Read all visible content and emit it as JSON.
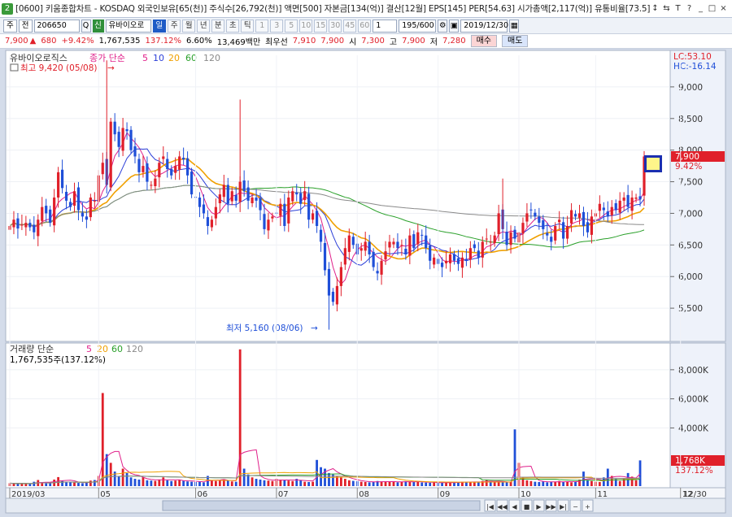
{
  "window": {
    "badge": "2",
    "title": "[0600] 키움종합차트 - KOSDAQ 외국인보유[65(천)] 주식수[26,792(천)] 액면[500] 자본금[134(억)] 결산[12월] EPS[145] PER[54.63] 시가총액[2,117(억)] 유통비율[73.5]",
    "controls": [
      "↕",
      "⇆",
      "T",
      "?",
      "_",
      "□",
      "×"
    ]
  },
  "toolbar": {
    "type": "주",
    "sep": "전",
    "code": "206650",
    "search_icon": "Q",
    "name_badge": "신",
    "name": "유바이오로",
    "periods": [
      "일",
      "주",
      "월",
      "년",
      "분",
      "초",
      "틱"
    ],
    "active_period": "일",
    "minutes": [
      "1",
      "3",
      "5",
      "10",
      "15",
      "30",
      "45",
      "60"
    ],
    "min_sel": "1",
    "count": "195/600",
    "date": "2019/12/30"
  },
  "info": {
    "price": "7,900",
    "arrow": "▲",
    "change": "680",
    "pct": "+9.42%",
    "volume": "1,767,535",
    "vol_ratio": "137.12%",
    "turnover": "6.60%",
    "amount": "13,469백만",
    "best_label": "최우선",
    "best1": "7,910",
    "best2": "7,900",
    "open_label": "시",
    "open": "7,300",
    "high_label": "고",
    "high": "7,900",
    "low_label": "저",
    "low": "7,280",
    "buy": "매수",
    "sell": "매도"
  },
  "price_panel": {
    "name": "유바이오로직스",
    "ma_label": "종가 단순",
    "ma": [
      "5",
      "10",
      "20",
      "60",
      "120"
    ],
    "ma_colors": [
      "#e0208a",
      "#2c3fd8",
      "#f0a000",
      "#2aa02a",
      "#8a8a8a"
    ],
    "high_note": "최고 9,420 (05/08)",
    "low_note": "최저 5,160 (08/06)",
    "lc": "LC:53.10",
    "hc": "HC:-16.14",
    "yaxis": [
      "9,000",
      "8,500",
      "8,000",
      "7,500",
      "7,000",
      "6,500",
      "6,000",
      "5,500"
    ],
    "last_price": "7,900",
    "last_pct": "9.42%"
  },
  "volume_panel": {
    "title": "거래량 단순",
    "ma": [
      "5",
      "20",
      "60",
      "120"
    ],
    "current": "1,767,535주(137.12%)",
    "yaxis": [
      "8,000K",
      "6,000K",
      "4,000K"
    ],
    "last_vol": "1,768K",
    "last_pct": "137.12%"
  },
  "xaxis": {
    "labels": [
      "2019/03",
      "05",
      "06",
      "07",
      "08",
      "09",
      "10",
      "11",
      "12"
    ],
    "end_label": "12/30"
  },
  "navigator": {
    "buttons": [
      "|◀",
      "◀◀",
      "◀",
      "■",
      "▶",
      "▶▶",
      "▶|",
      "−",
      "+"
    ]
  },
  "chart_data": {
    "type": "candlestick",
    "price_range": [
      5000,
      9500
    ],
    "volume_range": [
      0,
      9500000
    ],
    "closes": [
      6800,
      6900,
      6760,
      6820,
      6850,
      6780,
      6700,
      6900,
      7100,
      7000,
      6850,
      7250,
      7650,
      7400,
      7200,
      7100,
      7350,
      7050,
      6950,
      6900,
      7250,
      7200,
      7600,
      7800,
      7450,
      8450,
      8250,
      8050,
      8350,
      8300,
      8000,
      7900,
      7650,
      7750,
      7500,
      7450,
      7550,
      7800,
      7900,
      7700,
      7600,
      7750,
      7900,
      7850,
      7600,
      7300,
      7250,
      7100,
      7000,
      6800,
      6900,
      7100,
      7300,
      7450,
      7150,
      7350,
      7200,
      7500,
      7350,
      7200,
      7250,
      7200,
      7050,
      6750,
      6900,
      6950,
      7000,
      7150,
      6800,
      7250,
      7350,
      7300,
      7150,
      7350,
      6900,
      7000,
      6800,
      6550,
      6100,
      5700,
      5600,
      5850,
      6150,
      6450,
      6650,
      6500,
      6350,
      6450,
      6550,
      6350,
      6150,
      6050,
      6250,
      6400,
      6550,
      6550,
      6450,
      6500,
      6350,
      6650,
      6450,
      6700,
      6650,
      6450,
      6250,
      6300,
      6200,
      6150,
      6250,
      6350,
      6250,
      6200,
      6300,
      6250,
      6450,
      6450,
      6300,
      6550,
      6600,
      6550,
      6650,
      7000,
      6750,
      6500,
      6700,
      6600,
      6700,
      6850,
      7000,
      7050,
      6950,
      6850,
      6750,
      6650,
      6550,
      6800,
      6900,
      6600,
      6800,
      7050,
      6950,
      7000,
      6800,
      6700,
      6950,
      7000,
      7150,
      7050,
      6950,
      7100,
      7050,
      7200,
      7250,
      7100,
      7250,
      7250,
      7220,
      7900
    ],
    "volumes_k": [
      200,
      180,
      160,
      220,
      150,
      140,
      300,
      420,
      260,
      190,
      200,
      450,
      620,
      380,
      300,
      260,
      250,
      220,
      200,
      240,
      380,
      420,
      700,
      6400,
      2200,
      1600,
      1000,
      700,
      1200,
      900,
      600,
      500,
      450,
      600,
      400,
      380,
      360,
      450,
      600,
      400,
      350,
      380,
      420,
      360,
      320,
      300,
      280,
      300,
      260,
      700,
      400,
      350,
      380,
      450,
      400,
      320,
      300,
      9400,
      1200,
      800,
      600,
      500,
      450,
      400,
      380,
      350,
      500,
      450,
      420,
      380,
      350,
      500,
      400,
      300,
      280,
      300,
      1800,
      1300,
      1200,
      900,
      800,
      700,
      600,
      500,
      400,
      360,
      340,
      300,
      280,
      260,
      300,
      350,
      320,
      300,
      280,
      320,
      260,
      300,
      340,
      280,
      300,
      320,
      250,
      240,
      230,
      260,
      220,
      250,
      240,
      230,
      260,
      280,
      300,
      290,
      260,
      300,
      280,
      350,
      420,
      320,
      280,
      300,
      260,
      280,
      300,
      3900,
      1600,
      600,
      400,
      350,
      300,
      280,
      320,
      260,
      300,
      280,
      350,
      300,
      320,
      260,
      300,
      450,
      1000,
      400,
      350,
      300,
      280,
      600,
      1200,
      700,
      500,
      350,
      500,
      900,
      650,
      400,
      1768
    ]
  }
}
